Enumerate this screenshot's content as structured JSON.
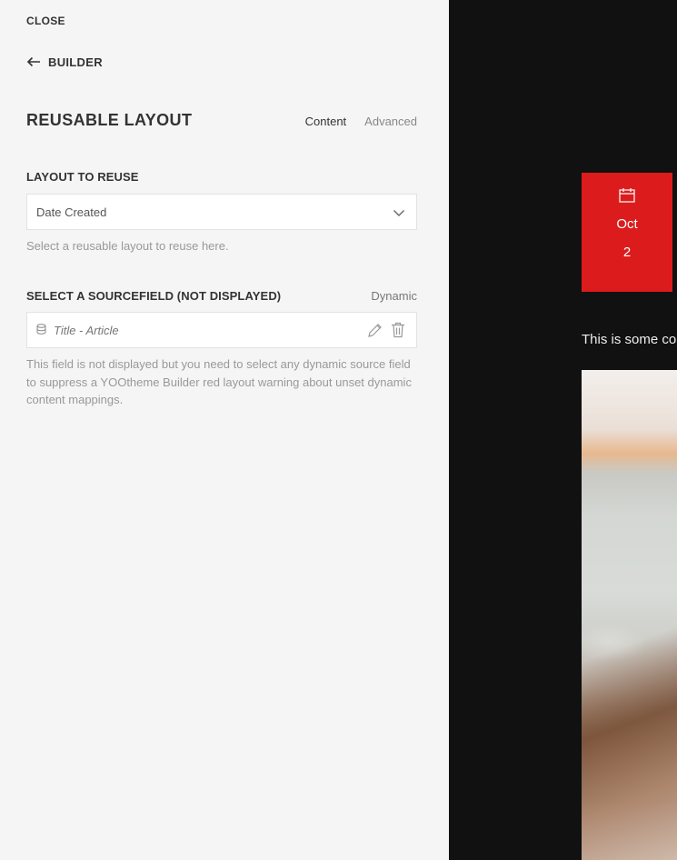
{
  "panel": {
    "close_label": "CLOSE",
    "back_label": "BUILDER",
    "title": "REUSABLE LAYOUT",
    "tabs": [
      {
        "label": "Content",
        "active": true
      },
      {
        "label": "Advanced",
        "active": false
      }
    ]
  },
  "layout_field": {
    "label": "LAYOUT TO REUSE",
    "selected": "Date Created",
    "help": "Select a reusable layout to reuse here."
  },
  "source_field": {
    "label": "SELECT A SOURCEFIELD (NOT DISPLAYED)",
    "dynamic_label": "Dynamic",
    "value": "Title - Article",
    "help": "This field is not displayed but you need to select any dynamic source field to suppress a YOOtheme Builder red layout warning about unset dynamic content mappings."
  },
  "preview": {
    "month": "Oct",
    "day": "2",
    "text": "This is some co"
  },
  "colors": {
    "accent_red": "#dc1c1c",
    "panel_bg": "#f5f5f5",
    "preview_bg": "#111111"
  },
  "icons": {
    "back": "arrow-left-icon",
    "dropdown": "chevron-down-icon",
    "source": "database-icon",
    "edit": "pencil-icon",
    "delete": "trash-icon",
    "date": "calendar-icon"
  }
}
